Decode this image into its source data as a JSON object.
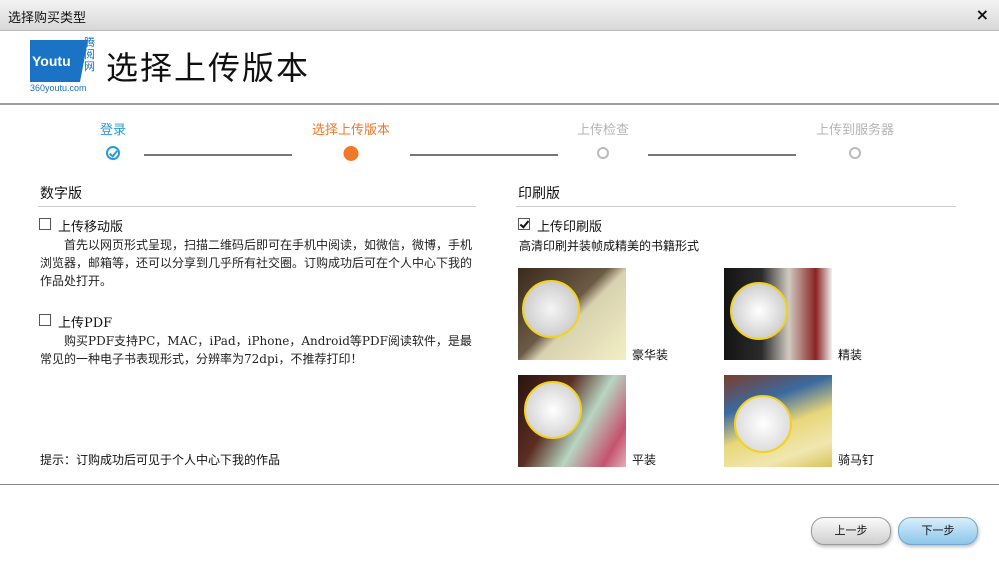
{
  "window": {
    "title": "选择购买类型",
    "close_glyph": "×"
  },
  "logo": {
    "brand_text": "Youtu",
    "brand_cn": "腾阅网",
    "url_text": "360youtu.com"
  },
  "header": {
    "title": "选择上传版本"
  },
  "steps": [
    {
      "label": "登录",
      "state": "done"
    },
    {
      "label": "选择上传版本",
      "state": "active"
    },
    {
      "label": "上传检查",
      "state": "todo"
    },
    {
      "label": "上传到服务器",
      "state": "todo"
    }
  ],
  "digital": {
    "section_title": "数字版",
    "options": [
      {
        "label": "上传移动版",
        "checked": false,
        "description": "首先以网页形式呈现，扫描二维码后即可在手机中阅读，如微信，微博，手机浏览器，邮箱等，还可以分享到几乎所有社交圈。订购成功后可在个人中心下我的作品处打开。"
      },
      {
        "label": "上传PDF",
        "checked": false,
        "description": "购买PDF支持PC，MAC，iPad，iPhone，Android等PDF阅读软件，是最常见的一种电子书表现形式，分辨率为72dpi，不推荐打印！"
      }
    ],
    "hint": "提示：订购成功后可见于个人中心下我的作品"
  },
  "print": {
    "section_title": "印刷版",
    "option_label": "上传印刷版",
    "checked": true,
    "description": "高清印刷并装帧成精美的书籍形式",
    "bindings": [
      {
        "label": "豪华装"
      },
      {
        "label": "精装"
      },
      {
        "label": "平装"
      },
      {
        "label": "骑马钉"
      }
    ]
  },
  "buttons": {
    "prev_label": "上一步",
    "next_label": "下一步"
  },
  "colors": {
    "step_done": "#2a9ad6",
    "step_active": "#f07828",
    "step_todo": "#b5b5b5",
    "brand_blue": "#1a73c4"
  }
}
